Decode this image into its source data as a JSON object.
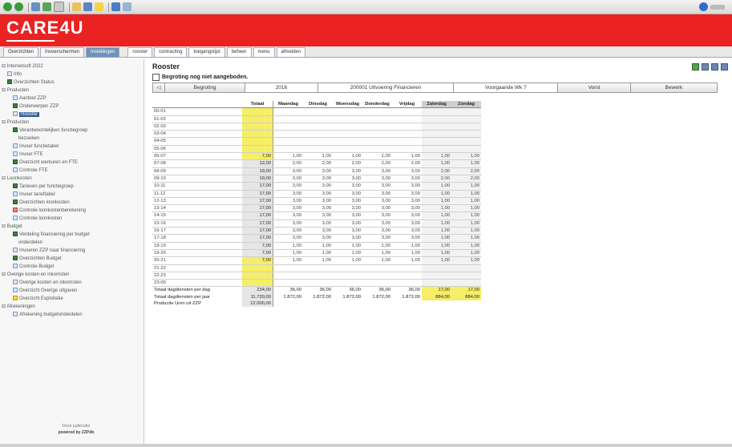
{
  "app": {
    "logo_text": "CARE4U"
  },
  "toolbar": {
    "buttons": [
      "back-icon",
      "forward-icon",
      "home-icon",
      "refresh-icon",
      "print-icon",
      "mail-icon",
      "search-icon",
      "favorites-icon",
      "history-icon",
      "tools-icon"
    ],
    "right_icon": "help-icon"
  },
  "tabs": {
    "main": [
      {
        "label": "Overzichten",
        "active": false
      },
      {
        "label": "Invoerschermen",
        "active": false
      },
      {
        "label": "Instellingen",
        "active": true
      }
    ],
    "sub": [
      "rooster",
      "contracting",
      "toegangslijst",
      "beheer",
      "menu",
      "afmelden"
    ]
  },
  "sidebar": {
    "items": [
      {
        "label": "Internetsoft 2022",
        "level": 0,
        "icon": "",
        "selected": false
      },
      {
        "label": "Info",
        "level": 1,
        "icon": "doc",
        "selected": false
      },
      {
        "label": "Overzichten Status",
        "level": 1,
        "icon": "grp",
        "selected": false
      },
      {
        "label": "Producten",
        "level": 0,
        "icon": "",
        "selected": false
      },
      {
        "label": "Aanbod ZZP",
        "level": 2,
        "icon": "doc",
        "selected": false
      },
      {
        "label": "Onderwerpen ZZP",
        "level": 2,
        "icon": "grp",
        "selected": false
      },
      {
        "label": "Rooster",
        "level": 2,
        "icon": "doc",
        "selected": true
      },
      {
        "label": "Producten",
        "level": 0,
        "icon": "",
        "selected": false
      },
      {
        "label": "Verantwoordelijken functiegroep",
        "level": 2,
        "icon": "grp",
        "selected": false
      },
      {
        "label": "bezoeken",
        "level": 3,
        "icon": "",
        "selected": false
      },
      {
        "label": "Invoer functietabel",
        "level": 2,
        "icon": "doc",
        "selected": false
      },
      {
        "label": "Invoer FTE",
        "level": 2,
        "icon": "doc",
        "selected": false
      },
      {
        "label": "Overzicht werkuren en FTE",
        "level": 2,
        "icon": "grp",
        "selected": false
      },
      {
        "label": "Controle FTE",
        "level": 2,
        "icon": "doc",
        "selected": false
      },
      {
        "label": "Loonkosten",
        "level": 0,
        "icon": "",
        "selected": false
      },
      {
        "label": "Tarieven per functiegroep",
        "level": 2,
        "icon": "grp",
        "selected": false
      },
      {
        "label": "Invoer tarieftabel",
        "level": 2,
        "icon": "doc",
        "selected": false
      },
      {
        "label": "Overzichten loonkosten",
        "level": 2,
        "icon": "grp",
        "selected": false
      },
      {
        "label": "Controle loonkostenberekening",
        "level": 2,
        "icon": "red",
        "selected": false
      },
      {
        "label": "Controle loonkosten",
        "level": 2,
        "icon": "doc",
        "selected": false
      },
      {
        "label": "Budget",
        "level": 0,
        "icon": "",
        "selected": false
      },
      {
        "label": "Verdeling financiering per budget",
        "level": 2,
        "icon": "grp",
        "selected": false
      },
      {
        "label": "onderdelen",
        "level": 3,
        "icon": "",
        "selected": false
      },
      {
        "label": "Invoeren ZZP naar financiering",
        "level": 2,
        "icon": "doc",
        "selected": false
      },
      {
        "label": "Overzichten Budget",
        "level": 2,
        "icon": "grp",
        "selected": false
      },
      {
        "label": "Controle Budget",
        "level": 2,
        "icon": "doc",
        "selected": false
      },
      {
        "label": "Overige kosten en inkomsten",
        "level": 0,
        "icon": "",
        "selected": false
      },
      {
        "label": "Overige kosten en inkomsten",
        "level": 2,
        "icon": "doc",
        "selected": false
      },
      {
        "label": "Overzicht Overige uitgaven",
        "level": 2,
        "icon": "doc",
        "selected": false
      },
      {
        "label": "Overzicht Exploitatie",
        "level": 2,
        "icon": "star",
        "selected": false
      },
      {
        "label": "Afrekeningen",
        "level": 0,
        "icon": "",
        "selected": false
      },
      {
        "label": "Afrekening budgetonderdelen",
        "level": 2,
        "icon": "doc",
        "selected": false
      }
    ],
    "footer_text": "Deze publicatie",
    "footer_brand": "powered by ZZPdb"
  },
  "main": {
    "title": "Rooster",
    "checkbox_label": "Begroting nog niet aangeboden.",
    "nav": [
      {
        "label": "◁",
        "button": false
      },
      {
        "label": "Begroting",
        "button": true
      },
      {
        "label": "2016",
        "button": false
      },
      {
        "label": "200001 Uitvoering Financieren",
        "button": false
      },
      {
        "label": "Voorgaande Wk 7",
        "button": false
      },
      {
        "label": "Vorst",
        "button": true
      },
      {
        "label": "Bewerk",
        "button": true
      }
    ],
    "columns": [
      "Totaal",
      "Maandag",
      "Dinsdag",
      "Woensdag",
      "Donderdag",
      "Vrijdag",
      "Zaterdag",
      "Zondag"
    ],
    "rows": [
      {
        "label": "00-01",
        "total": "",
        "days": [
          "",
          "",
          "",
          "",
          "",
          "",
          ""
        ]
      },
      {
        "label": "01-02",
        "total": "",
        "days": [
          "",
          "",
          "",
          "",
          "",
          "",
          ""
        ]
      },
      {
        "label": "02-03",
        "total": "",
        "days": [
          "",
          "",
          "",
          "",
          "",
          "",
          ""
        ]
      },
      {
        "label": "03-04",
        "total": "",
        "days": [
          "",
          "",
          "",
          "",
          "",
          "",
          ""
        ]
      },
      {
        "label": "04-05",
        "total": "",
        "days": [
          "",
          "",
          "",
          "",
          "",
          "",
          ""
        ]
      },
      {
        "label": "05-06",
        "total": "",
        "days": [
          "",
          "",
          "",
          "",
          "",
          "",
          ""
        ]
      },
      {
        "label": "06-07",
        "total": "7,00",
        "days": [
          "1,00",
          "1,00",
          "1,00",
          "1,00",
          "1,00",
          "1,00",
          "1,00"
        ]
      },
      {
        "label": "07-08",
        "total": "12,00",
        "days": [
          "2,00",
          "2,00",
          "2,00",
          "2,00",
          "2,00",
          "1,00",
          "1,00"
        ]
      },
      {
        "label": "08-09",
        "total": "19,00",
        "days": [
          "3,00",
          "3,00",
          "3,00",
          "3,00",
          "3,00",
          "2,00",
          "2,00"
        ]
      },
      {
        "label": "09-10",
        "total": "19,00",
        "days": [
          "3,00",
          "3,00",
          "3,00",
          "3,00",
          "3,00",
          "2,00",
          "2,00"
        ]
      },
      {
        "label": "10-11",
        "total": "17,00",
        "days": [
          "3,00",
          "3,00",
          "3,00",
          "3,00",
          "3,00",
          "1,00",
          "1,00"
        ]
      },
      {
        "label": "11-12",
        "total": "17,00",
        "days": [
          "3,00",
          "3,00",
          "3,00",
          "3,00",
          "3,00",
          "1,00",
          "1,00"
        ]
      },
      {
        "label": "12-13",
        "total": "17,00",
        "days": [
          "3,00",
          "3,00",
          "3,00",
          "3,00",
          "3,00",
          "1,00",
          "1,00"
        ]
      },
      {
        "label": "13-14",
        "total": "17,00",
        "days": [
          "3,00",
          "3,00",
          "3,00",
          "3,00",
          "3,00",
          "1,00",
          "1,00"
        ]
      },
      {
        "label": "14-15",
        "total": "17,00",
        "days": [
          "3,00",
          "3,00",
          "3,00",
          "3,00",
          "3,00",
          "1,00",
          "1,00"
        ]
      },
      {
        "label": "15-16",
        "total": "17,00",
        "days": [
          "3,00",
          "3,00",
          "3,00",
          "3,00",
          "3,00",
          "1,00",
          "1,00"
        ]
      },
      {
        "label": "16-17",
        "total": "17,00",
        "days": [
          "3,00",
          "3,00",
          "3,00",
          "3,00",
          "3,00",
          "1,00",
          "1,00"
        ]
      },
      {
        "label": "17-18",
        "total": "17,00",
        "days": [
          "3,00",
          "3,00",
          "3,00",
          "3,00",
          "3,00",
          "1,00",
          "1,00"
        ]
      },
      {
        "label": "18-19",
        "total": "7,00",
        "days": [
          "1,00",
          "1,00",
          "1,00",
          "1,00",
          "1,00",
          "1,00",
          "1,00"
        ]
      },
      {
        "label": "19-20",
        "total": "7,00",
        "days": [
          "1,00",
          "1,00",
          "1,00",
          "1,00",
          "1,00",
          "1,00",
          "1,00"
        ]
      },
      {
        "label": "20-21",
        "total": "7,00",
        "days": [
          "1,00",
          "1,00",
          "1,00",
          "1,00",
          "1,00",
          "1,00",
          "1,00"
        ]
      },
      {
        "label": "21-22",
        "total": "",
        "days": [
          "",
          "",
          "",
          "",
          "",
          "",
          ""
        ]
      },
      {
        "label": "22-23",
        "total": "",
        "days": [
          "",
          "",
          "",
          "",
          "",
          "",
          ""
        ]
      },
      {
        "label": "23-00",
        "total": "",
        "days": [
          "",
          "",
          "",
          "",
          "",
          "",
          ""
        ]
      }
    ],
    "summary": [
      {
        "label": "Totaal dagdiensten per dag",
        "total": "234,00",
        "days": [
          "36,00",
          "36,00",
          "36,00",
          "36,00",
          "36,00",
          "17,00",
          "17,00"
        ]
      },
      {
        "label": "Totaal dagdiensten per jaar",
        "total": "11.720,00",
        "days": [
          "1.872,00",
          "1.872,00",
          "1.872,00",
          "1.872,00",
          "1.872,00",
          "884,00",
          "884,00"
        ]
      },
      {
        "label": "Productie Uren uit ZZP",
        "total": "12.000,00",
        "days": [
          "",
          "",
          "",
          "",
          "",
          "",
          ""
        ]
      }
    ]
  },
  "colors": {
    "brand_red": "#ea2222",
    "highlight_yellow": "#f5ee66",
    "active_tab": "#6e93b8"
  }
}
